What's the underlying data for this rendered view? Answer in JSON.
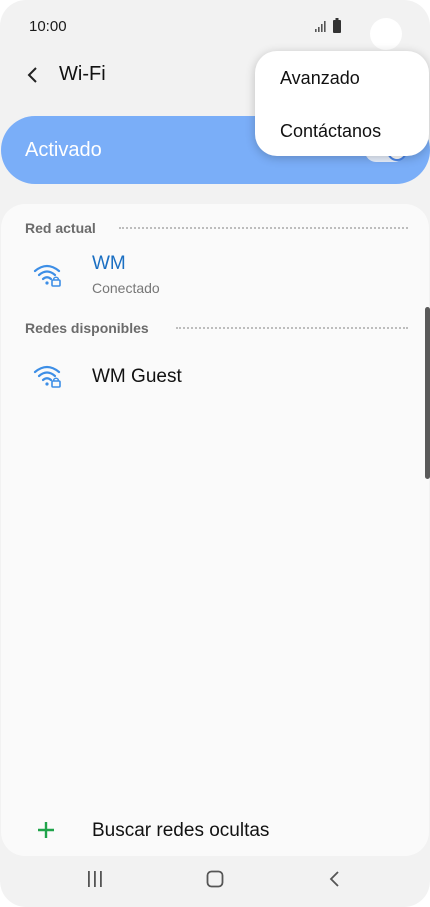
{
  "status_bar": {
    "time": "10:00",
    "icons": [
      "signal-icon",
      "battery-icon"
    ]
  },
  "header": {
    "title": "Wi-Fi",
    "back_icon": "chevron-left-icon"
  },
  "master_toggle": {
    "label": "Activado",
    "enabled": true
  },
  "overflow_menu": {
    "items": [
      {
        "label": "Avanzado"
      },
      {
        "label": "Contáctanos"
      }
    ]
  },
  "current_network": {
    "section_label": "Red actual",
    "name": "WM",
    "status": "Conectado",
    "icon": "wifi-lock-icon"
  },
  "available_networks": {
    "section_label": "Redes disponibles",
    "items": [
      {
        "name": "WM Guest",
        "icon": "wifi-lock-icon"
      }
    ]
  },
  "add_network": {
    "label": "Buscar redes ocultas",
    "icon": "plus-icon"
  },
  "nav_bar": {
    "buttons": [
      "recent-apps-icon",
      "home-icon",
      "back-icon"
    ]
  },
  "colors": {
    "accent": "#7aaef8",
    "link_blue": "#1b6fc2",
    "wifi_icon": "#3d8ee6",
    "plus_green": "#1fa34a",
    "background": "#f2f2f2",
    "card": "#fafafa"
  }
}
